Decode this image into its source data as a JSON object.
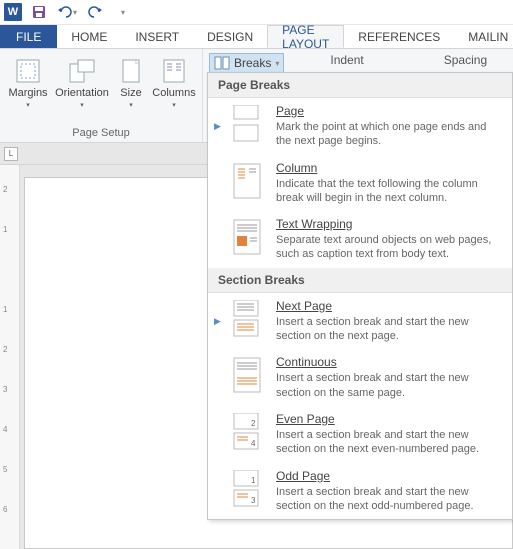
{
  "qat": {
    "save_name": "save",
    "undo_name": "undo",
    "redo_name": "redo"
  },
  "tabs": {
    "file": "FILE",
    "home": "HOME",
    "insert": "INSERT",
    "design": "DESIGN",
    "page_layout": "PAGE LAYOUT",
    "references": "REFERENCES",
    "mailings": "MAILIN"
  },
  "page_setup": {
    "title": "Page Setup",
    "margins": "Margins",
    "orientation": "Orientation",
    "size": "Size",
    "columns": "Columns"
  },
  "breaks_btn": "Breaks",
  "indent_label": "Indent",
  "spacing_label": "Spacing",
  "dropdown": {
    "page_breaks_header": "Page Breaks",
    "section_breaks_header": "Section Breaks",
    "page": {
      "title": "Page",
      "desc": "Mark the point at which one page ends and the next page begins."
    },
    "column": {
      "title": "Column",
      "desc": "Indicate that the text following the column break will begin in the next column."
    },
    "text_wrapping": {
      "title": "Text Wrapping",
      "desc": "Separate text around objects on web pages, such as caption text from body text."
    },
    "next_page": {
      "title": "Next Page",
      "desc": "Insert a section break and start the new section on the next page."
    },
    "continuous": {
      "title": "Continuous",
      "desc": "Insert a section break and start the new section on the same page."
    },
    "even_page": {
      "title": "Even Page",
      "desc": "Insert a section break and start the new section on the next even-numbered page."
    },
    "odd_page": {
      "title": "Odd Page",
      "desc": "Insert a section break and start the new section on the next odd-numbered page."
    }
  },
  "ruler_ticks": [
    "2",
    "1",
    "1",
    "2",
    "3",
    "4",
    "5",
    "6"
  ]
}
